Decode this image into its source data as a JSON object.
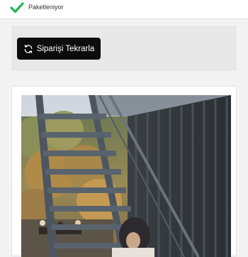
{
  "order": {
    "status": {
      "icon": "checkmark-icon",
      "text": "Paketleniyor",
      "color": "#23b55a"
    },
    "reorder": {
      "icon": "refresh-icon",
      "label": "Siparişi Tekrarla"
    },
    "product_photo": {
      "alt": "woman-in-hijab-on-outdoor-metal-staircase"
    }
  },
  "colors": {
    "background": "#f3f3f3",
    "button": "#0c0c0c",
    "button_text": "#ffffff"
  }
}
